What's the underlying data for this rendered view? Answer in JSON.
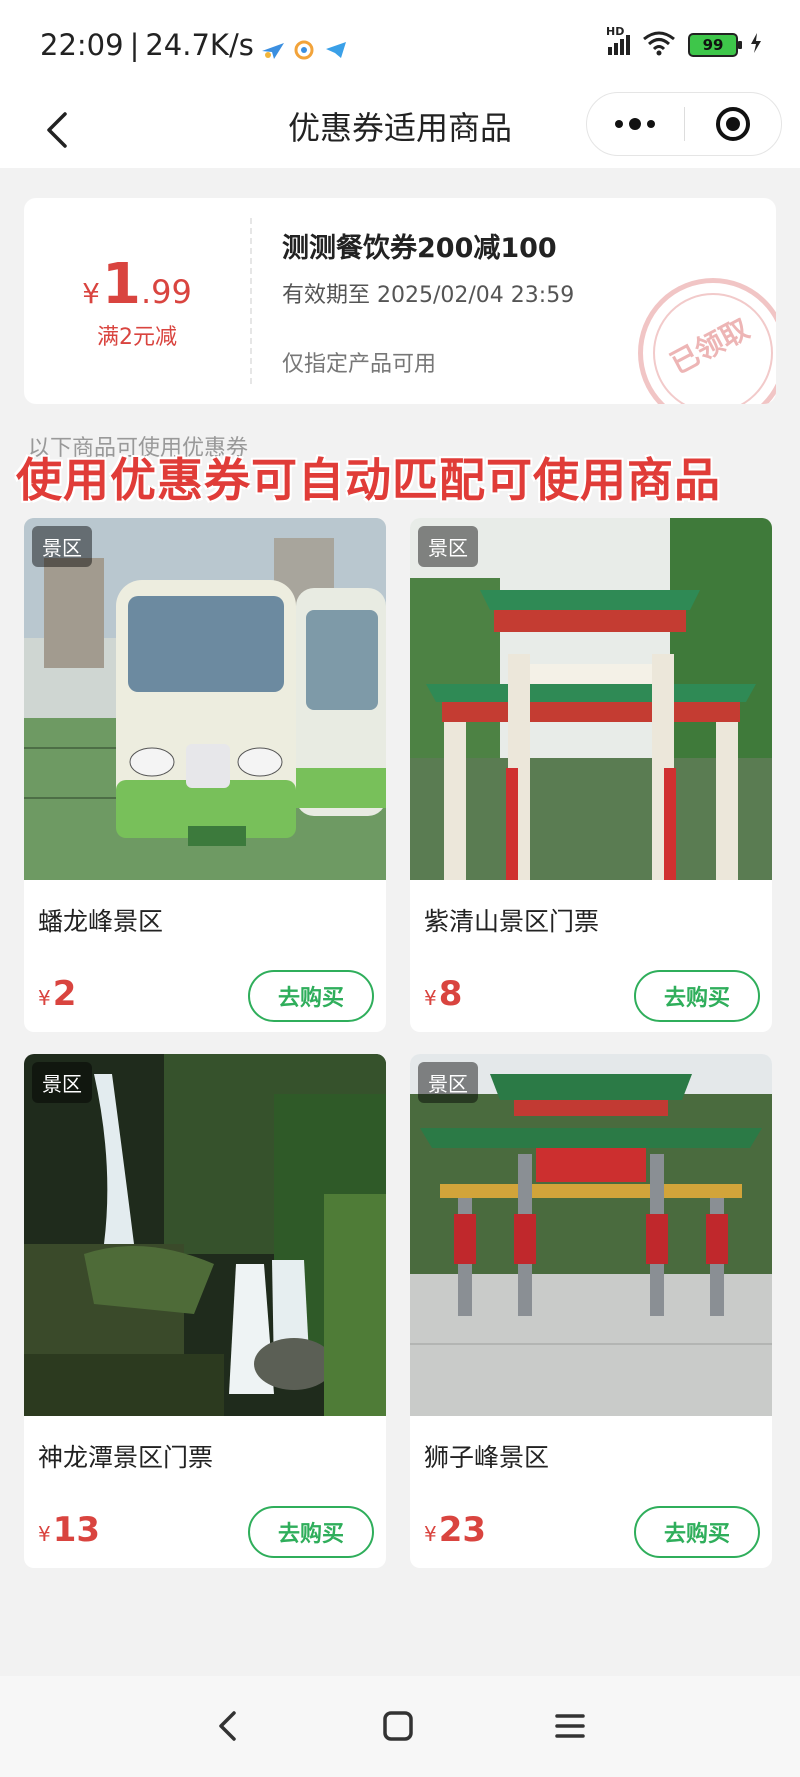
{
  "status_bar": {
    "time": "22:09",
    "net_speed": "24.7K/s",
    "network": "HD",
    "battery": "99"
  },
  "nav": {
    "title": "优惠券适用商品",
    "more_icon": "more-dots-icon",
    "target_icon": "target-icon"
  },
  "coupon": {
    "currency": "¥",
    "amount_int": "1",
    "amount_dec": ".99",
    "condition": "满2元减",
    "name": "测测餐饮券200减100",
    "valid_until": "有效期至 2025/02/04 23:59",
    "scope": "仅指定产品可用",
    "stamp": "已领取"
  },
  "section_label": "以下商品可使用优惠券",
  "overlay_caption": "使用优惠券可自动匹配可使用商品",
  "products": [
    {
      "tag": "景区",
      "name": "蟠龙峰景区",
      "currency": "¥",
      "price": "2",
      "buy": "去购买"
    },
    {
      "tag": "景区",
      "name": "紫清山景区门票",
      "currency": "¥",
      "price": "8",
      "buy": "去购买"
    },
    {
      "tag": "景区",
      "name": "神龙潭景区门票",
      "currency": "¥",
      "price": "13",
      "buy": "去购买"
    },
    {
      "tag": "景区",
      "name": "狮子峰景区",
      "currency": "¥",
      "price": "23",
      "buy": "去购买"
    }
  ],
  "colors": {
    "accent_red": "#d9443f",
    "accent_green": "#2fae5b"
  }
}
